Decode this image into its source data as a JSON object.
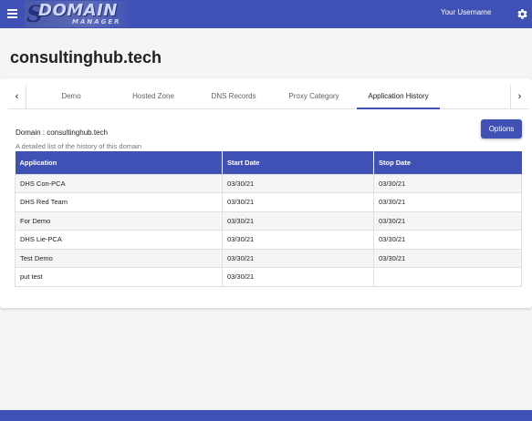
{
  "header": {
    "logo_initial": "S",
    "logo_main": "DOMAIN",
    "logo_sub": "MANAGER",
    "username": "Your Username",
    "menu_icon": "hamburger-menu-icon",
    "settings_icon": "gear-icon"
  },
  "page": {
    "title": "consultinghub.tech"
  },
  "tabs": {
    "left_arrow": "‹",
    "right_arrow": "›",
    "items": [
      {
        "label": "Demo"
      },
      {
        "label": "Hosted Zone"
      },
      {
        "label": "DNS Records"
      },
      {
        "label": "Proxy Category"
      },
      {
        "label": "Application History"
      }
    ],
    "active_index": 4
  },
  "panel": {
    "domain_label": "Domain : consultinghub.tech",
    "options_button": "Options",
    "description": "A detailed list of the history of this domain"
  },
  "table": {
    "columns": [
      "Application",
      "Start Date",
      "Stop Date"
    ],
    "rows": [
      [
        "DHS Con-PCA",
        "03/30/21",
        "03/30/21"
      ],
      [
        "DHS Red Team",
        "03/30/21",
        "03/30/21"
      ],
      [
        "For Demo",
        "03/30/21",
        "03/30/21"
      ],
      [
        "DHS Lie-PCA",
        "03/30/21",
        "03/30/21"
      ],
      [
        "Test Demo",
        "03/30/21",
        "03/30/21"
      ],
      [
        "put test",
        "03/30/21",
        ""
      ]
    ]
  },
  "colors": {
    "primary": "#3f51b5",
    "background": "#f5f5f5"
  }
}
